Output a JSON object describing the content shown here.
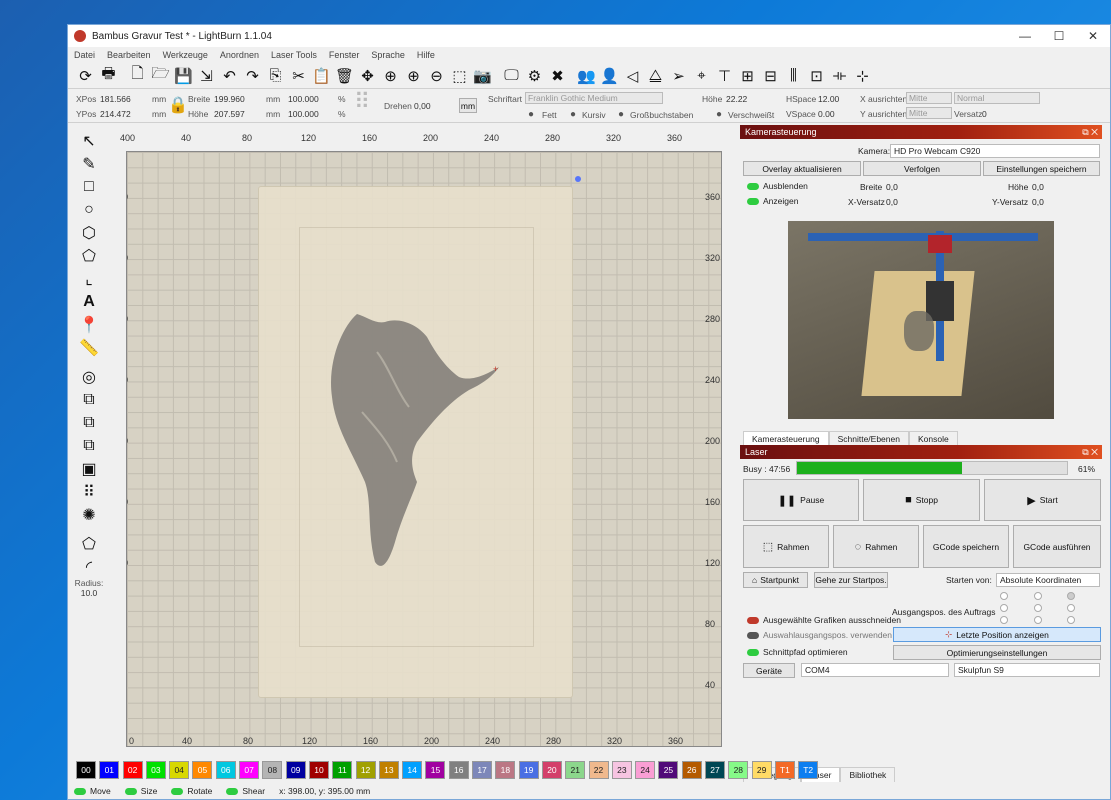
{
  "window": {
    "title": "Bambus Gravur Test * - LightBurn 1.1.04",
    "controls": [
      "—",
      "☐",
      "✕"
    ]
  },
  "menu": [
    "Datei",
    "Bearbeiten",
    "Werkzeuge",
    "Anordnen",
    "Laser Tools",
    "Fenster",
    "Sprache",
    "Hilfe"
  ],
  "props": {
    "xpos_label": "XPos",
    "xpos": "181.566",
    "ypos_label": "YPos",
    "ypos": "214.472",
    "unit": "mm",
    "width_label": "Breite",
    "width": "199.960",
    "height_label": "Höhe",
    "height": "207.597",
    "scale_w": "100.000",
    "scale_h": "100.000",
    "pct": "%",
    "rotate_label": "Drehen",
    "rotate": "0,00",
    "mm_btn": "mm",
    "font_label": "Schriftart",
    "font": "Franklin Gothic Medium",
    "font_height_label": "Höhe",
    "font_height": "22.22",
    "hspace_label": "HSpace",
    "hspace": "12.00",
    "vspace_label": "VSpace",
    "vspace": "0.00",
    "xalign_label": "X ausrichten",
    "xalign": "Mitte",
    "yalign_label": "Y ausrichten",
    "yalign": "Mitte",
    "style": "Normal",
    "offset_label": "Versatz",
    "offset": "0",
    "bold": "Fett",
    "italic": "Kursiv",
    "caps": "Großbuchstaben",
    "welded": "Verschweißt"
  },
  "rulers": {
    "top": [
      "400",
      "40",
      "80",
      "120",
      "160",
      "200",
      "240",
      "280",
      "320",
      "360"
    ],
    "bottom": [
      "0",
      "40",
      "80",
      "120",
      "160",
      "200",
      "240",
      "280",
      "320",
      "360"
    ],
    "left": [
      "360",
      "320",
      "280",
      "240",
      "200",
      "160",
      "120",
      "80",
      "40"
    ],
    "right": [
      "360",
      "320",
      "280",
      "240",
      "200",
      "160",
      "120",
      "80",
      "40"
    ]
  },
  "camera": {
    "title": "Kamerasteuerung",
    "camera_label": "Kamera:",
    "camera": "HD Pro Webcam C920",
    "overlay_btn": "Overlay aktualisieren",
    "track_btn": "Verfolgen",
    "save_btn": "Einstellungen speichern",
    "hide": "Ausblenden",
    "show": "Anzeigen",
    "width_label": "Breite",
    "width": "0,0",
    "height_label": "Höhe",
    "height": "0,0",
    "xoff_label": "X-Versatz",
    "xoff": "0,0",
    "yoff_label": "Y-Versatz",
    "yoff": "0,0",
    "tabs": [
      "Kamerasteuerung",
      "Schnitte/Ebenen",
      "Konsole"
    ]
  },
  "laser": {
    "title": "Laser",
    "busy": "Busy : 47:56",
    "progress": 61,
    "progress_label": "61%",
    "pause": "Pause",
    "stop": "Stopp",
    "start": "Start",
    "frame1": "Rahmen",
    "frame2": "Rahmen",
    "save_gcode": "GCode speichern",
    "run_gcode": "GCode ausführen",
    "home": "Startpunkt",
    "goto_origin": "Gehe zur Startpos.",
    "start_from_label": "Starten von:",
    "start_from": "Absolute Koordinaten",
    "job_origin_label": "Ausgangspos. des Auftrags",
    "cut_selected": "Ausgewählte Grafiken ausschneiden",
    "use_sel_origin": "Auswahlausgangspos. verwenden",
    "optimize_path": "Schnittpfad optimieren",
    "show_last": "Letzte Position anzeigen",
    "opt_settings": "Optimierungseinstellungen",
    "devices": "Geräte",
    "port": "COM4",
    "device": "Skulpfun S9",
    "tabs": [
      "Bewegung",
      "Laser",
      "Bibliothek"
    ]
  },
  "left_tools": {
    "radius_label": "Radius:",
    "radius": "10.0"
  },
  "palette": [
    {
      "l": "00",
      "c": "#000000"
    },
    {
      "l": "01",
      "c": "#0000ff"
    },
    {
      "l": "02",
      "c": "#ff0000"
    },
    {
      "l": "03",
      "c": "#00e000"
    },
    {
      "l": "04",
      "c": "#d8d800"
    },
    {
      "l": "05",
      "c": "#ff8800"
    },
    {
      "l": "06",
      "c": "#00c8e0"
    },
    {
      "l": "07",
      "c": "#ff00ff"
    },
    {
      "l": "08",
      "c": "#b4b4b4"
    },
    {
      "l": "09",
      "c": "#0000a0"
    },
    {
      "l": "10",
      "c": "#a00000"
    },
    {
      "l": "11",
      "c": "#00a000"
    },
    {
      "l": "12",
      "c": "#a0a000"
    },
    {
      "l": "13",
      "c": "#c08000"
    },
    {
      "l": "14",
      "c": "#00a0ff"
    },
    {
      "l": "15",
      "c": "#a000a0"
    },
    {
      "l": "16",
      "c": "#808080"
    },
    {
      "l": "17",
      "c": "#7d87b9"
    },
    {
      "l": "18",
      "c": "#bb7784"
    },
    {
      "l": "19",
      "c": "#4a6fe3"
    },
    {
      "l": "20",
      "c": "#d33f6a"
    },
    {
      "l": "21",
      "c": "#8cd78c"
    },
    {
      "l": "22",
      "c": "#f0b98d"
    },
    {
      "l": "23",
      "c": "#f6c4e1"
    },
    {
      "l": "24",
      "c": "#fa9ed4"
    },
    {
      "l": "25",
      "c": "#500a78"
    },
    {
      "l": "26",
      "c": "#b45a00"
    },
    {
      "l": "27",
      "c": "#004754"
    },
    {
      "l": "28",
      "c": "#86fa88"
    },
    {
      "l": "29",
      "c": "#ffdb66"
    },
    {
      "l": "T1",
      "c": "#f36926"
    },
    {
      "l": "T2",
      "c": "#0c7ef0"
    }
  ],
  "status": {
    "move": "Move",
    "size": "Size",
    "rotate": "Rotate",
    "shear": "Shear",
    "coords": "x: 398.00, y: 395.00 mm"
  }
}
